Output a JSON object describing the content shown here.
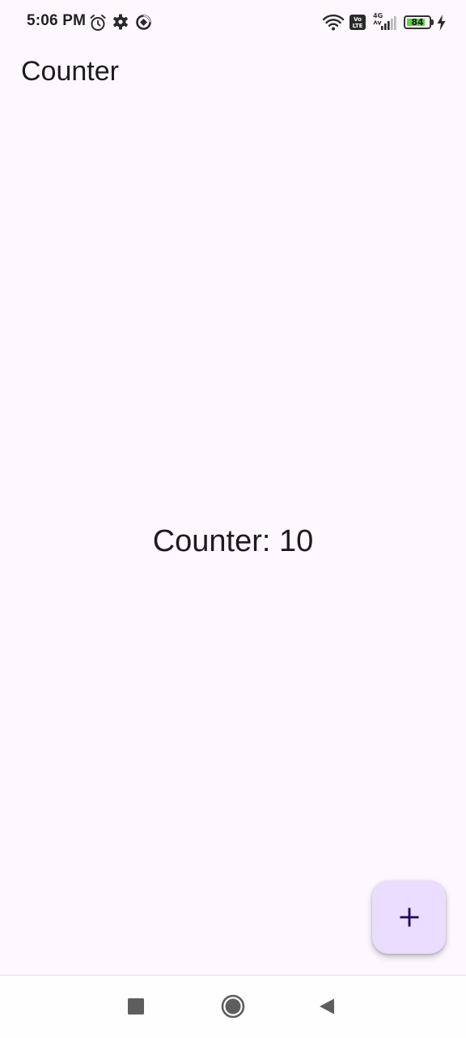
{
  "status_bar": {
    "time": "5:06 PM",
    "icons": [
      "alarm-icon",
      "gear-icon",
      "data-saver-icon",
      "wifi-icon",
      "volte-icon",
      "signal-icon",
      "battery-icon",
      "charging-icon"
    ],
    "volte_label_top": "Vo",
    "volte_label_bottom": "LTE",
    "network_type": "4G",
    "battery_level": "84",
    "battery_fraction": 0.84,
    "battery_color": "#5cd33c"
  },
  "app_bar": {
    "title": "Counter"
  },
  "main": {
    "counter_text": "Counter: 10"
  },
  "fab": {
    "icon": "add-icon",
    "background": "#eaddff",
    "icon_color": "#21005d"
  },
  "nav_bar": {
    "buttons": [
      "recents-icon",
      "home-icon",
      "back-icon"
    ]
  },
  "theme": {
    "background": "#fdf7fe",
    "text_color": "#1d1b20"
  }
}
